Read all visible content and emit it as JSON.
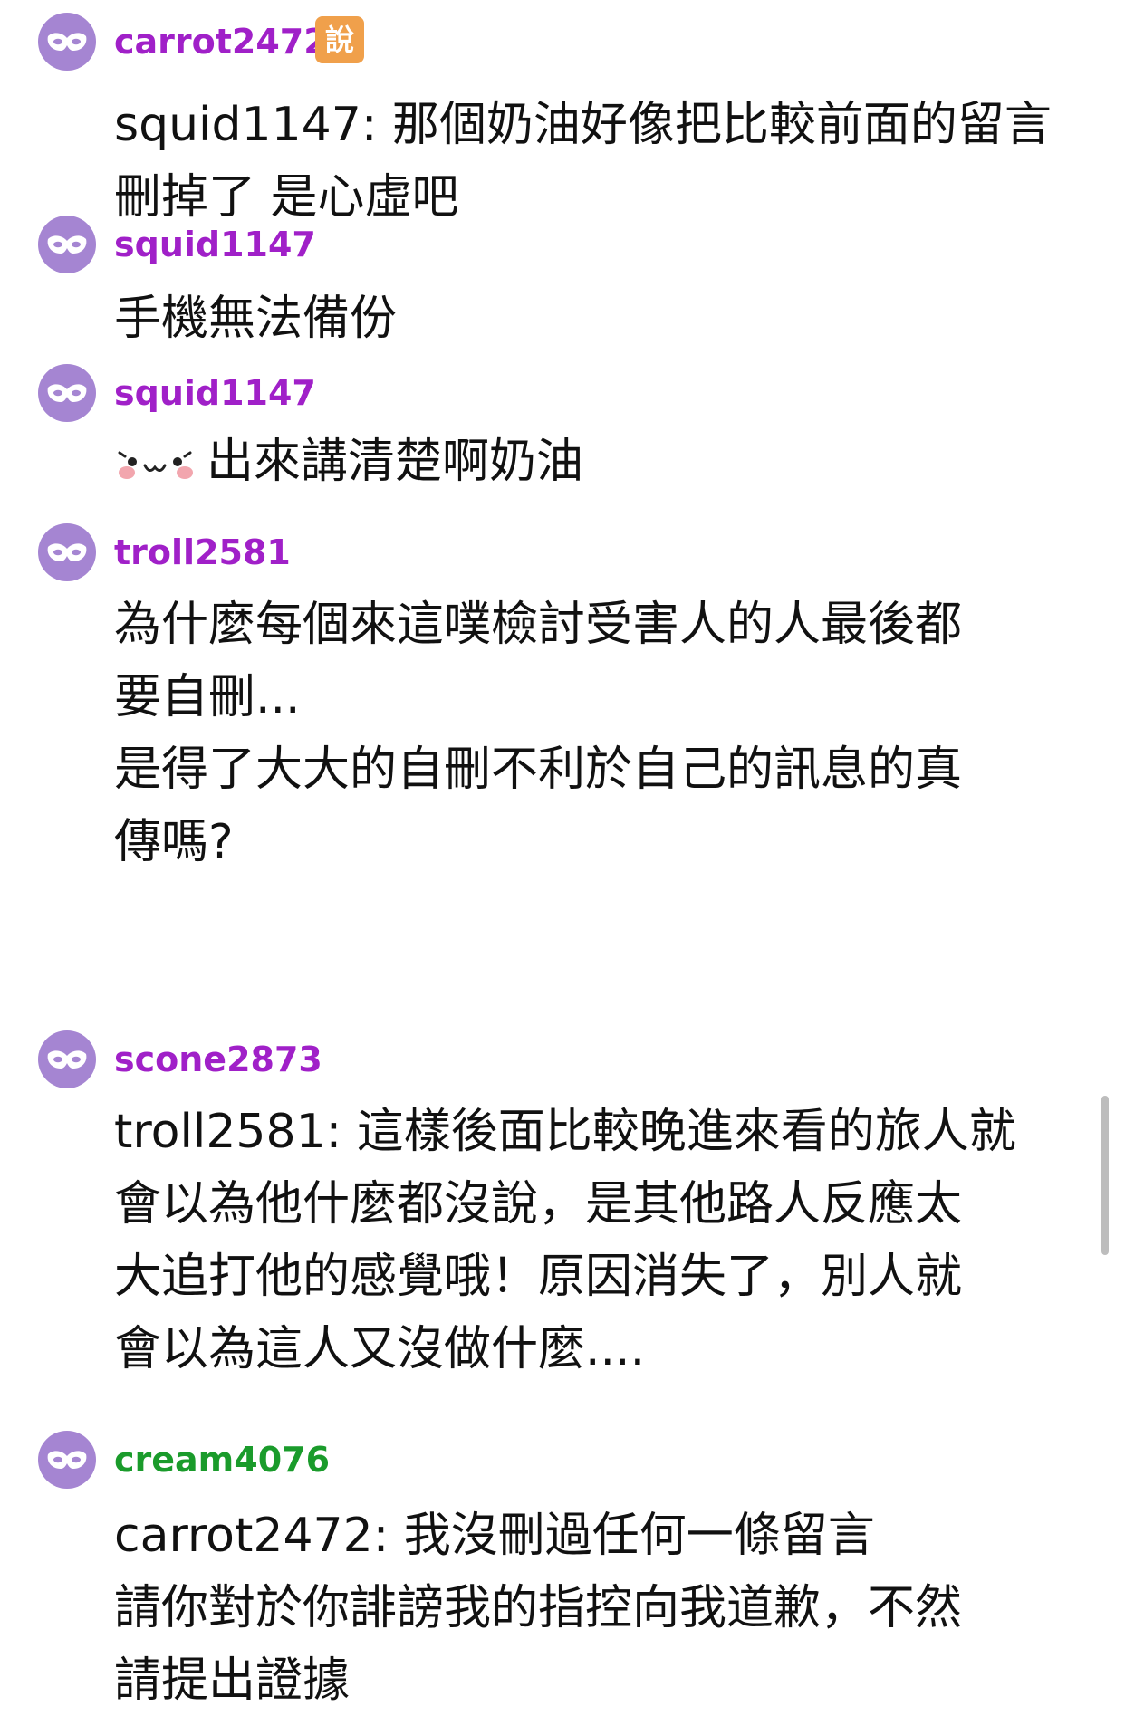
{
  "comments": [
    {
      "username": "carrot2472",
      "username_color": "#a020c8",
      "badge": "說",
      "text": "squid1147: 那個奶油好像把比較前面的留言\n刪掉了 是心虛吧"
    },
    {
      "username": "squid1147",
      "username_color": "#a020c8",
      "text": "手機無法備份"
    },
    {
      "username": "squid1147",
      "username_color": "#a020c8",
      "sticker": "·ω·",
      "text": "出來講清楚啊奶油"
    },
    {
      "username": "troll2581",
      "username_color": "#a020c8",
      "text": "為什麼每個來這噗檢討受害人的人最後都\n要自刪...\n是得了大大的自刪不利於自己的訊息的真\n傳嗎?"
    },
    {
      "username": "scone2873",
      "username_color": "#a020c8",
      "text": "troll2581: 這樣後面比較晚進來看的旅人就\n會以為他什麼都沒說，是其他路人反應太\n大追打他的感覺哦！原因消失了，別人就\n會以為這人又沒做什麼...."
    },
    {
      "username": "cream4076",
      "username_color": "#1a9b2b",
      "text": "carrot2472: 我沒刪過任何一條留言\n請你對於你誹謗我的指控向我道歉，不然\n請提出證據"
    }
  ],
  "icons": {
    "avatar": "mask-icon",
    "sticker": "cute-face-sticker"
  },
  "colors": {
    "avatar_bg": "#a585d2",
    "badge_bg": "#f0a04b",
    "text": "#111111"
  }
}
